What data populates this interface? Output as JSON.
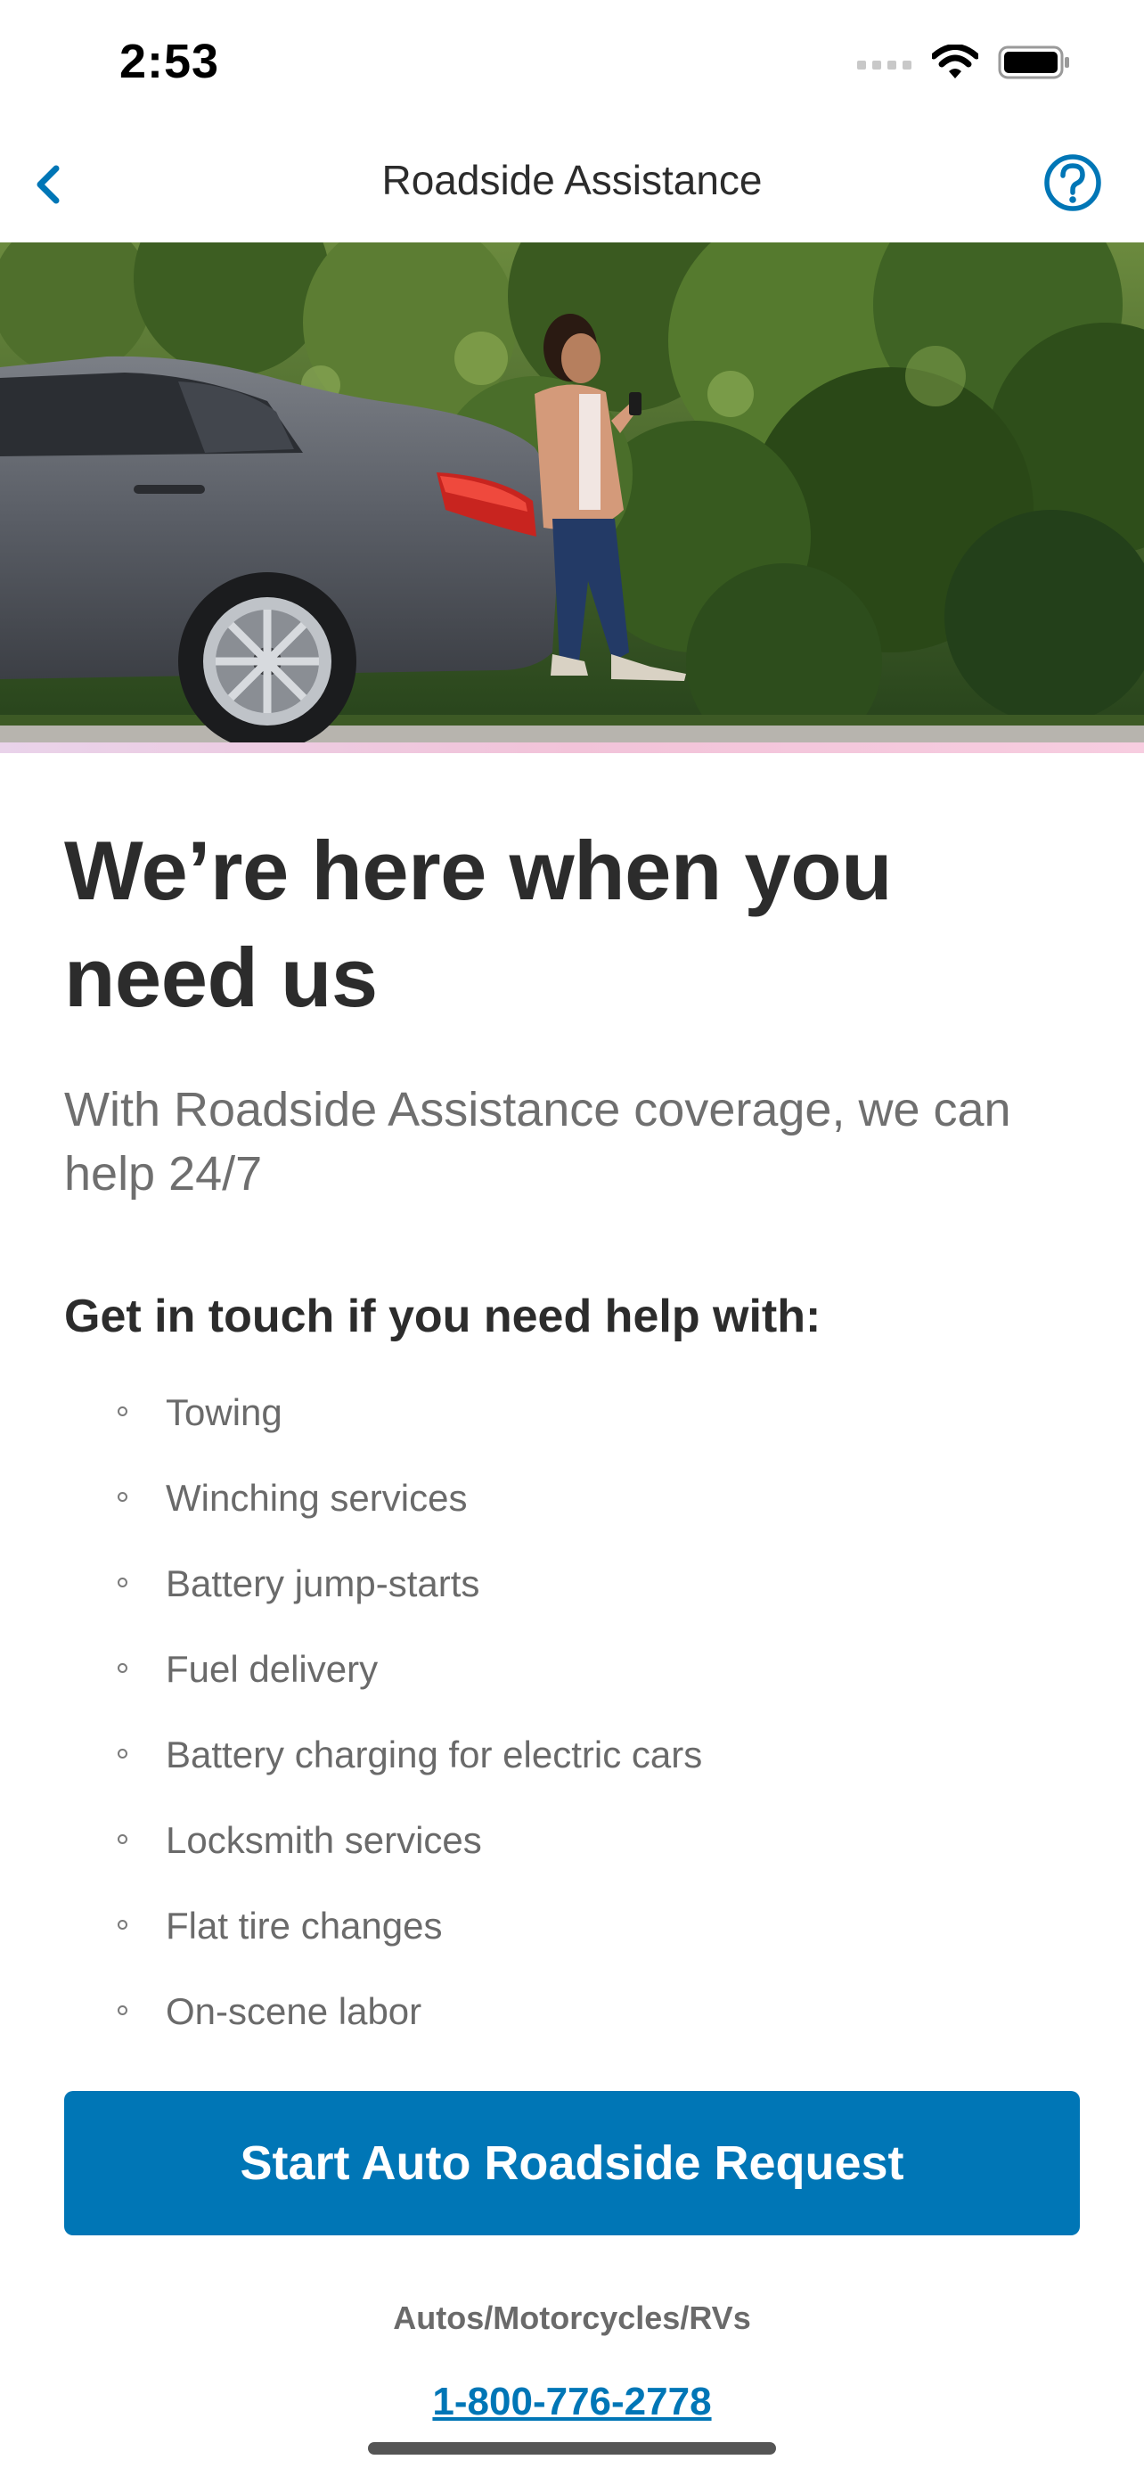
{
  "status_bar": {
    "time": "2:53"
  },
  "nav": {
    "title": "Roadside Assistance",
    "back_icon": "chevron-left-icon",
    "help_icon": "question-circle-icon"
  },
  "hero": {
    "alt": "Woman leaning on a gray sedan using a phone beside trees"
  },
  "content": {
    "headline_line1": "We’re here when you",
    "headline_line2": "need us",
    "subhead_line1": "With Roadside Assistance coverage, we can",
    "subhead_line2": "help 24/7",
    "list_title": "Get in touch if you need help with:",
    "list_items": [
      "Towing",
      "Winching services",
      "Battery jump-starts",
      "Fuel delivery",
      "Battery charging for electric cars",
      "Locksmith services",
      "Flat tire changes",
      "On-scene labor"
    ]
  },
  "cta": {
    "label": "Start Auto Roadside Request"
  },
  "phone": {
    "label": "Autos/Motorcycles/RVs",
    "number": "1-800-776-2778"
  },
  "colors": {
    "brand_blue": "#0076b6",
    "text_dark": "#2c2c2c",
    "text_gray": "#6a6a6a"
  }
}
